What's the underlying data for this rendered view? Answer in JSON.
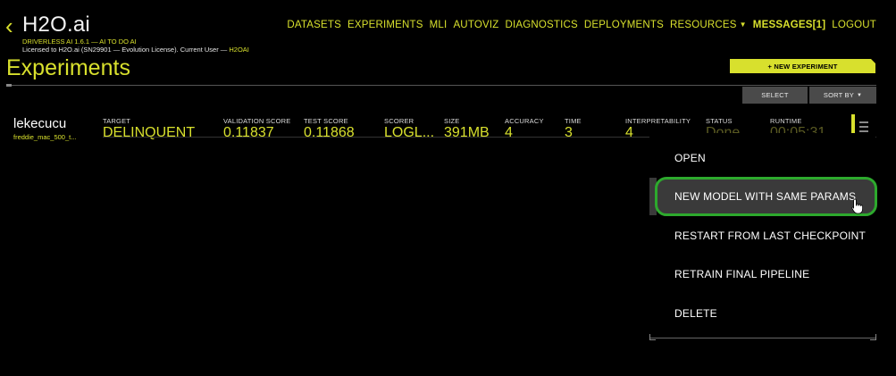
{
  "header": {
    "logo": "H2O.ai",
    "version_line": "DRIVERLESS AI 1.6.1 — AI TO DO AI",
    "license_prefix": "Licensed to H2O.ai (SN29901 — Evolution License). Current User — ",
    "current_user": "H2OAI"
  },
  "nav": {
    "datasets": "DATASETS",
    "experiments": "EXPERIMENTS",
    "mli": "MLI",
    "autoviz": "AUTOVIZ",
    "diagnostics": "DIAGNOSTICS",
    "deployments": "DEPLOYMENTS",
    "resources": "RESOURCES",
    "messages": "MESSAGES[1]",
    "logout": "LOGOUT"
  },
  "page": {
    "title": "Experiments",
    "new_experiment": "+ NEW EXPERIMENT",
    "select": "SELECT",
    "sort_by": "SORT BY"
  },
  "experiment": {
    "name": "lekecucu",
    "dataset": "freddie_mac_500_t...",
    "columns": [
      {
        "label": "TARGET",
        "value": "DELINQUENT"
      },
      {
        "label": "VALIDATION SCORE",
        "value": "0.11837"
      },
      {
        "label": "TEST SCORE",
        "value": "0.11868"
      },
      {
        "label": "SCORER",
        "value": "LOGL..."
      },
      {
        "label": "SIZE",
        "value": "391MB"
      },
      {
        "label": "ACCURACY",
        "value": "4"
      },
      {
        "label": "TIME",
        "value": "3"
      },
      {
        "label": "INTERPRETABILITY",
        "value": "4"
      },
      {
        "label": "STATUS",
        "value": "Done"
      },
      {
        "label": "RUNTIME",
        "value": "00:05:31"
      }
    ]
  },
  "context_menu": {
    "items": [
      "OPEN",
      "NEW MODEL WITH SAME PARAMS",
      "RESTART FROM LAST CHECKPOINT",
      "RETRAIN FINAL PIPELINE",
      "DELETE"
    ],
    "highlighted_index": 1
  },
  "colors": {
    "accent": "#d8e02d",
    "highlight_border": "#2da92d",
    "background": "#000000"
  }
}
